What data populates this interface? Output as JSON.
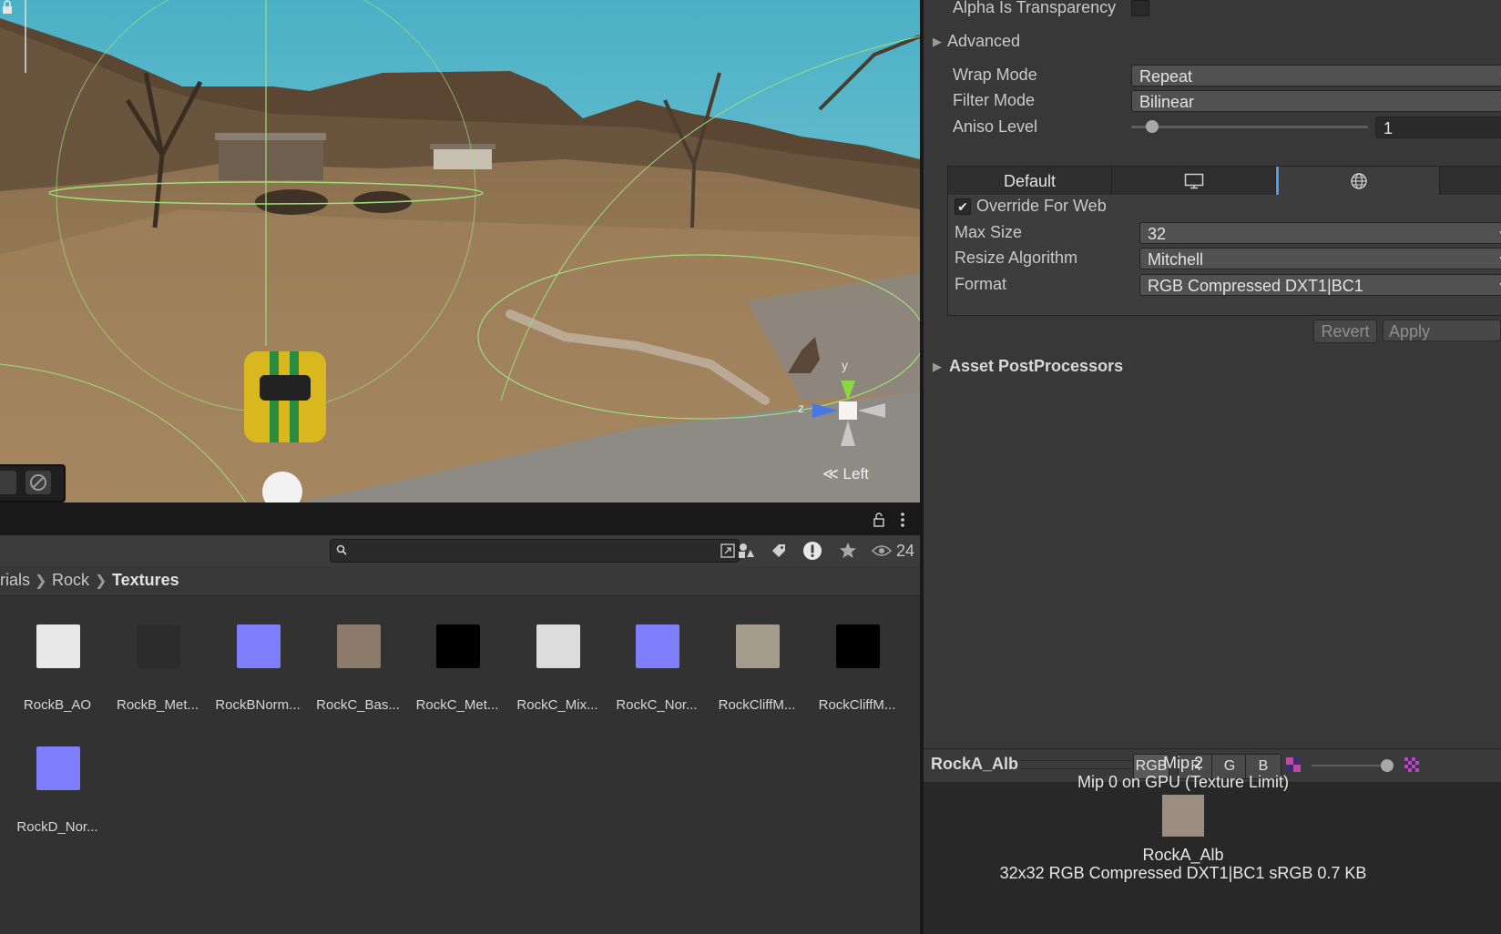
{
  "scene": {
    "gizmo": {
      "y_label": "y",
      "z_label": "z",
      "view_label": "Left"
    },
    "icons": [
      "lock-icon",
      "move-tool-icon",
      "eraser-tool-icon"
    ]
  },
  "project": {
    "toolbar": {
      "hidden_count": "24"
    },
    "breadcrumb": [
      "rials",
      "Rock",
      "Textures"
    ],
    "assets": [
      {
        "label": "RockB_AO",
        "color": "#e8e8e8"
      },
      {
        "label": "RockB_Met...",
        "color": "#2c2c2c"
      },
      {
        "label": "RockBNorm...",
        "color": "#7f7ffd"
      },
      {
        "label": "RockC_Bas...",
        "color": "#8c7a6b"
      },
      {
        "label": "RockC_Met...",
        "color": "#000000"
      },
      {
        "label": "RockC_Mix...",
        "color": "#dcdcdc"
      },
      {
        "label": "RockC_Nor...",
        "color": "#7f7ffd"
      },
      {
        "label": "RockCliffM...",
        "color": "#a59c8c"
      },
      {
        "label": "RockCliffM...",
        "color": "#000000"
      },
      {
        "label": "RockD_Nor...",
        "color": "#7f7ffd"
      }
    ]
  },
  "inspector": {
    "alpha_is_transparency": "Alpha Is Transparency",
    "advanced": "Advanced",
    "wrap_mode": {
      "label": "Wrap Mode",
      "value": "Repeat"
    },
    "filter_mode": {
      "label": "Filter Mode",
      "value": "Bilinear"
    },
    "aniso_level": {
      "label": "Aniso Level",
      "value": "1"
    },
    "platform_tabs": {
      "default": "Default",
      "icons": [
        "monitor-icon",
        "globe-icon"
      ]
    },
    "override": {
      "label": "Override For Web",
      "checked": true
    },
    "max_size": {
      "label": "Max Size",
      "value": "32"
    },
    "resize_algorithm": {
      "label": "Resize Algorithm",
      "value": "Mitchell"
    },
    "format": {
      "label": "Format",
      "value": "RGB Compressed DXT1|BC1"
    },
    "revert": "Revert",
    "apply": "Apply",
    "asset_postprocessors": "Asset PostProcessors"
  },
  "preview": {
    "name": "RockA_Alb",
    "channels": [
      "RGB",
      "R",
      "G",
      "B"
    ],
    "mip_line": "Mip 2",
    "gpu_line": "Mip 0 on GPU (Texture Limit)",
    "texture_name": "RockA_Alb",
    "info": "32x32  RGB Compressed DXT1|BC1 sRGB   0.7 KB"
  },
  "colors": {
    "accent_blue": "#4a9ee8",
    "scene_sky": "#58b4c8",
    "ground": "#9c7d58"
  }
}
